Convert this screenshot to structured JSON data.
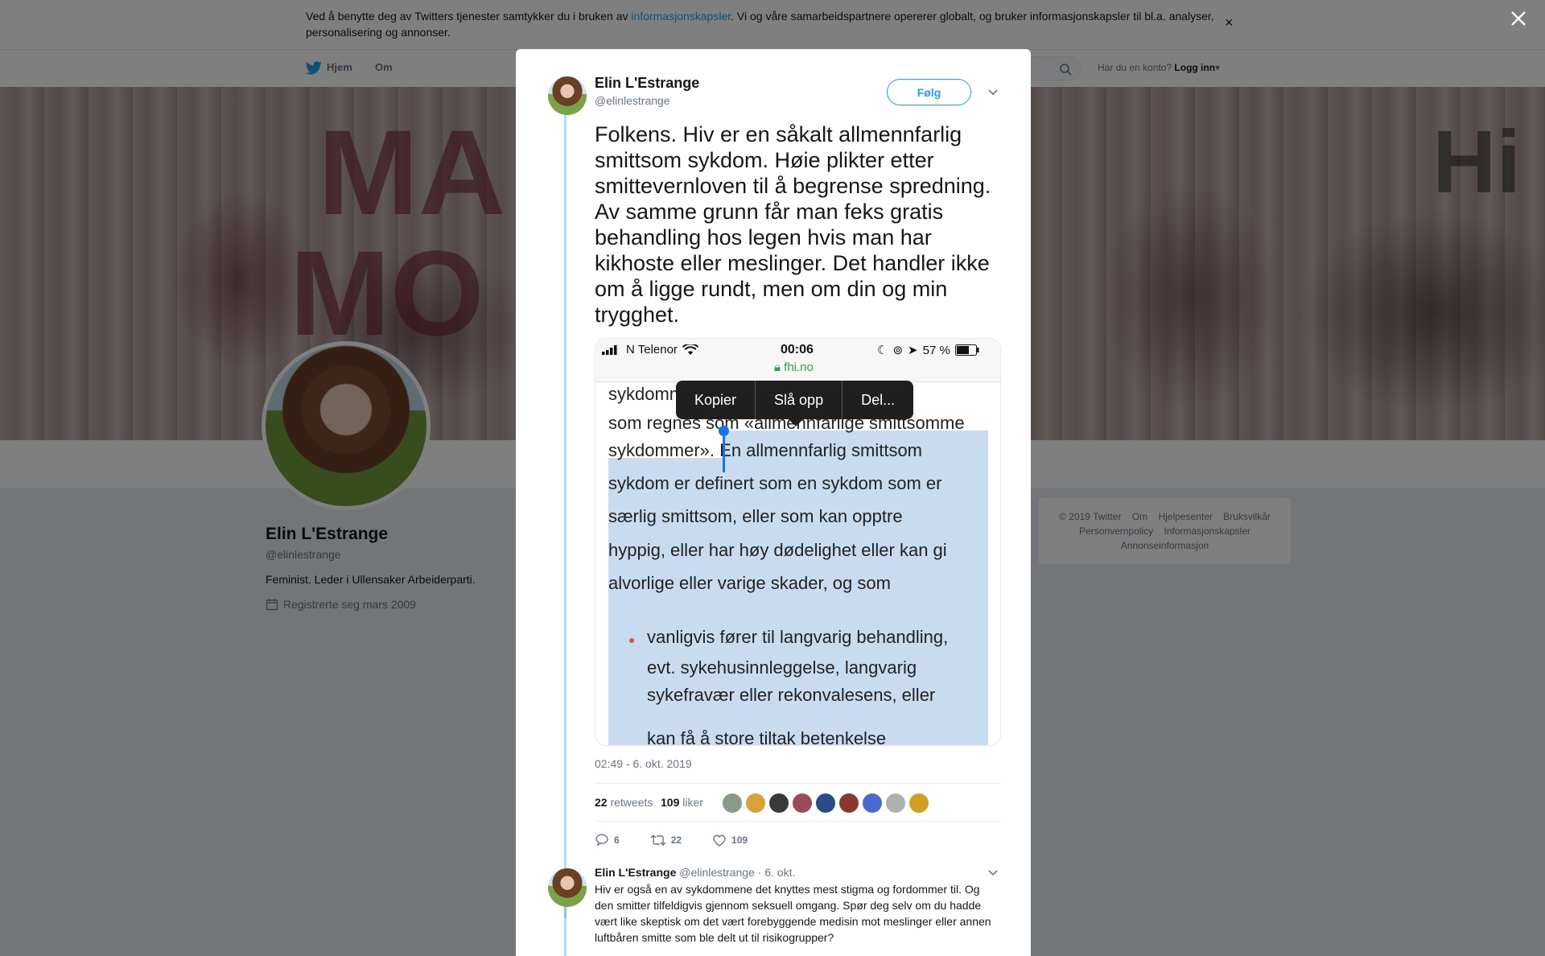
{
  "cookie_banner": {
    "text_before": "Ved å benytte deg av Twitters tjenester samtykker du i bruken av ",
    "link": "informasjonskapsler",
    "text_after": ". Vi og våre samarbeidspartnere opererer globalt, og bruker informasjonskapsler til bl.a. analyser, personalisering og annonser.",
    "close": "×"
  },
  "nav": {
    "home": "Hjem",
    "about": "Om",
    "account_prompt": "Har du en konto?",
    "login": "Logg inn"
  },
  "banner_text": [
    "MA",
    "MO",
    "Hi"
  ],
  "profile": {
    "name": "Elin L'Estrange",
    "handle": "@elinlestrange",
    "bio": "Feminist. Leder i Ullensaker Arbeiderparti.",
    "joined": "Registrerte seg mars 2009"
  },
  "footer": {
    "links": [
      "© 2019 Twitter",
      "Om",
      "Hjelpesenter",
      "Bruksvilkår",
      "Personvernpolicy",
      "Informasjonskapsler",
      "Annonseinformasjon"
    ]
  },
  "tweet": {
    "name": "Elin L'Estrange",
    "handle": "@elinlestrange",
    "follow": "Følg",
    "text": "Folkens. Hiv er en såkalt allmennfarlig smittsom sykdom. Høie plikter etter smittevernloven til å begrense spredning. Av samme grunn får man feks gratis behandling hos legen hvis man har kikhoste eller meslinger. Det handler ikke om å ligge rundt, men om din og min trygghet.",
    "timestamp": "02:49 - 6. okt. 2019",
    "retweets_count": "22",
    "retweets_label": "retweets",
    "likes_count": "109",
    "likes_label": "liker",
    "reply_count": "6",
    "retweet_action_count": "22",
    "like_action_count": "109"
  },
  "media": {
    "carrier": "N Telenor",
    "time": "00:06",
    "battery": "57 %",
    "url": "fhi.no",
    "context_menu": [
      "Kopier",
      "Slå opp",
      "Del..."
    ],
    "lines": [
      "sykdommer                                           or de",
      "som regnes som «allmennfarlige smittsomme",
      "sykdommer». En allmennfarlig smittsom",
      "sykdom er definert som en sykdom som er",
      "særlig smittsom, eller som kan opptre",
      "hyppig, eller har høy dødelighet eller kan gi",
      "alvorlige eller varige skader, og som"
    ],
    "bullet_lines": [
      "vanligvis fører til langvarig behandling,",
      "evt. sykehusinnleggelse, langvarig",
      "sykefravær eller rekonvalesens, eller",
      "kan få å store tiltak betenkelse"
    ]
  },
  "reply": {
    "name": "Elin L'Estrange",
    "handle": "@elinlestrange",
    "date": "· 6. okt.",
    "text": "Hiv er også en av sykdommene det knyttes mest stigma og fordommer til. Og den smitter tilfeldigvis gjennom seksuell omgang. Spør deg selv om du hadde vært like skeptisk om det vært forebyggende medisin mot meslinger eller annen luftbåren smitte som ble delt ut til risikogrupper?"
  },
  "colors": {
    "twitter_blue": "#1da1f2",
    "text_gray": "#657786",
    "selection": "#c8dbef"
  }
}
